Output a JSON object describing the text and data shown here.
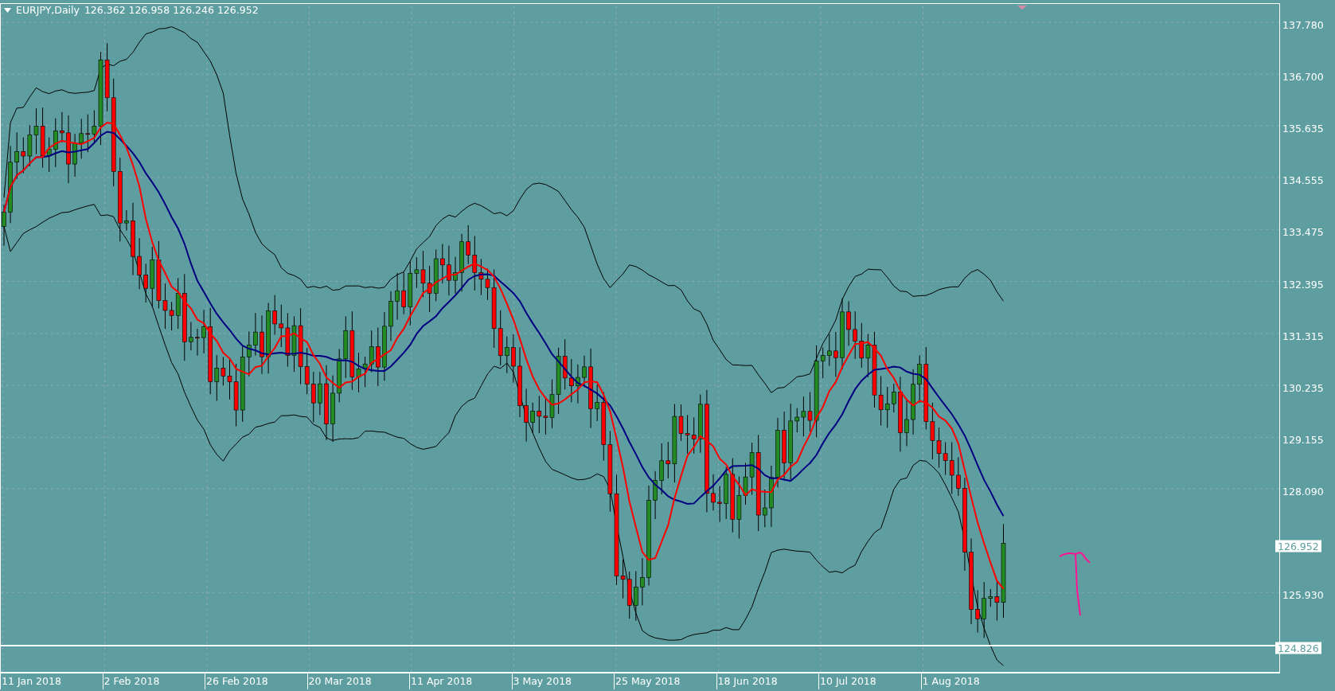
{
  "chart": {
    "title": "EURJPY,Daily",
    "quote": "126.362 126.958 126.246 126.952"
  },
  "price_axis": [
    {
      "label": "137.780",
      "kind": "tick"
    },
    {
      "label": "136.700",
      "kind": "tick"
    },
    {
      "label": "135.635",
      "kind": "tick"
    },
    {
      "label": "134.555",
      "kind": "tick"
    },
    {
      "label": "133.475",
      "kind": "tick"
    },
    {
      "label": "132.395",
      "kind": "tick"
    },
    {
      "label": "131.315",
      "kind": "tick"
    },
    {
      "label": "130.235",
      "kind": "tick"
    },
    {
      "label": "129.155",
      "kind": "tick"
    },
    {
      "label": "128.090",
      "kind": "tick"
    },
    {
      "label": "126.952",
      "kind": "marker"
    },
    {
      "label": "125.930",
      "kind": "tick"
    },
    {
      "label": "124.826",
      "kind": "marker"
    }
  ],
  "time_axis": [
    "11 Jan 2018",
    "2 Feb 2018",
    "26 Feb 2018",
    "20 Mar 2018",
    "11 Apr 2018",
    "3 May 2018",
    "25 May 2018",
    "18 Jun 2018",
    "10 Jul 2018",
    "1 Aug 2018"
  ]
}
